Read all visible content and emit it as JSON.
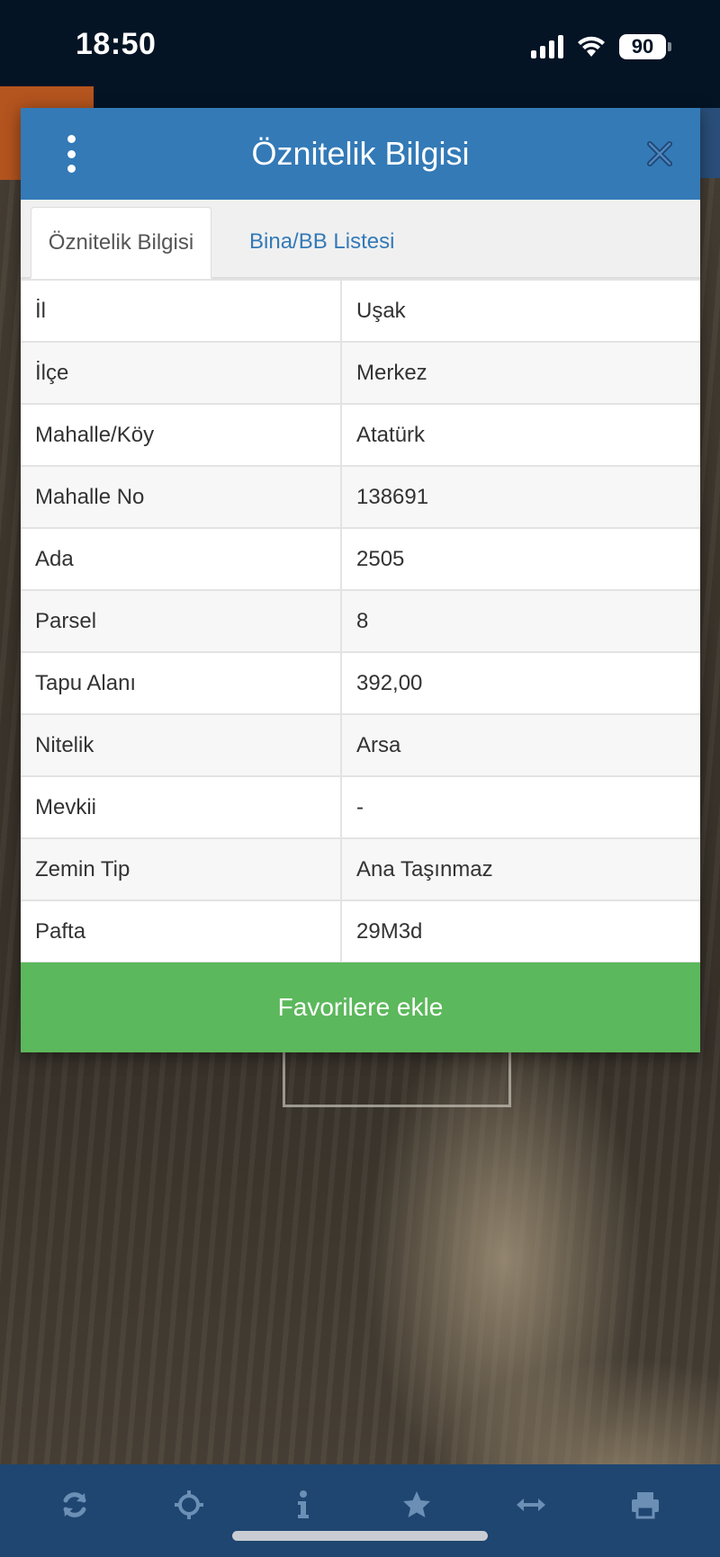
{
  "status_bar": {
    "time": "18:50",
    "battery": "90",
    "icons": [
      "cellular-signal-icon",
      "wifi-icon",
      "battery-icon"
    ]
  },
  "dialog": {
    "title": "Öznitelik Bilgisi",
    "menu_icon": "kebab-menu-icon",
    "close_icon": "close-icon",
    "tabs": [
      {
        "label": "Öznitelik Bilgisi",
        "active": true
      },
      {
        "label": "Bina/BB Listesi",
        "active": false
      }
    ],
    "rows": [
      {
        "key": "İl",
        "value": "Uşak"
      },
      {
        "key": "İlçe",
        "value": "Merkez"
      },
      {
        "key": "Mahalle/Köy",
        "value": "Atatürk"
      },
      {
        "key": "Mahalle No",
        "value": "138691"
      },
      {
        "key": "Ada",
        "value": "2505"
      },
      {
        "key": "Parsel",
        "value": "8"
      },
      {
        "key": "Tapu Alanı",
        "value": "392,00"
      },
      {
        "key": "Nitelik",
        "value": "Arsa"
      },
      {
        "key": "Mevkii",
        "value": "-"
      },
      {
        "key": "Zemin Tip",
        "value": "Ana Taşınmaz"
      },
      {
        "key": "Pafta",
        "value": "29M3d"
      }
    ],
    "favorite_button": "Favorilere ekle"
  },
  "toolbar": {
    "icons": [
      "refresh-icon",
      "crosshair-icon",
      "info-icon",
      "star-icon",
      "measure-icon",
      "print-icon"
    ]
  },
  "colors": {
    "header_blue": "#337ab7",
    "button_green": "#5cb85c",
    "toolbar_blue": "#1f4670",
    "status_bar": "#041425"
  }
}
